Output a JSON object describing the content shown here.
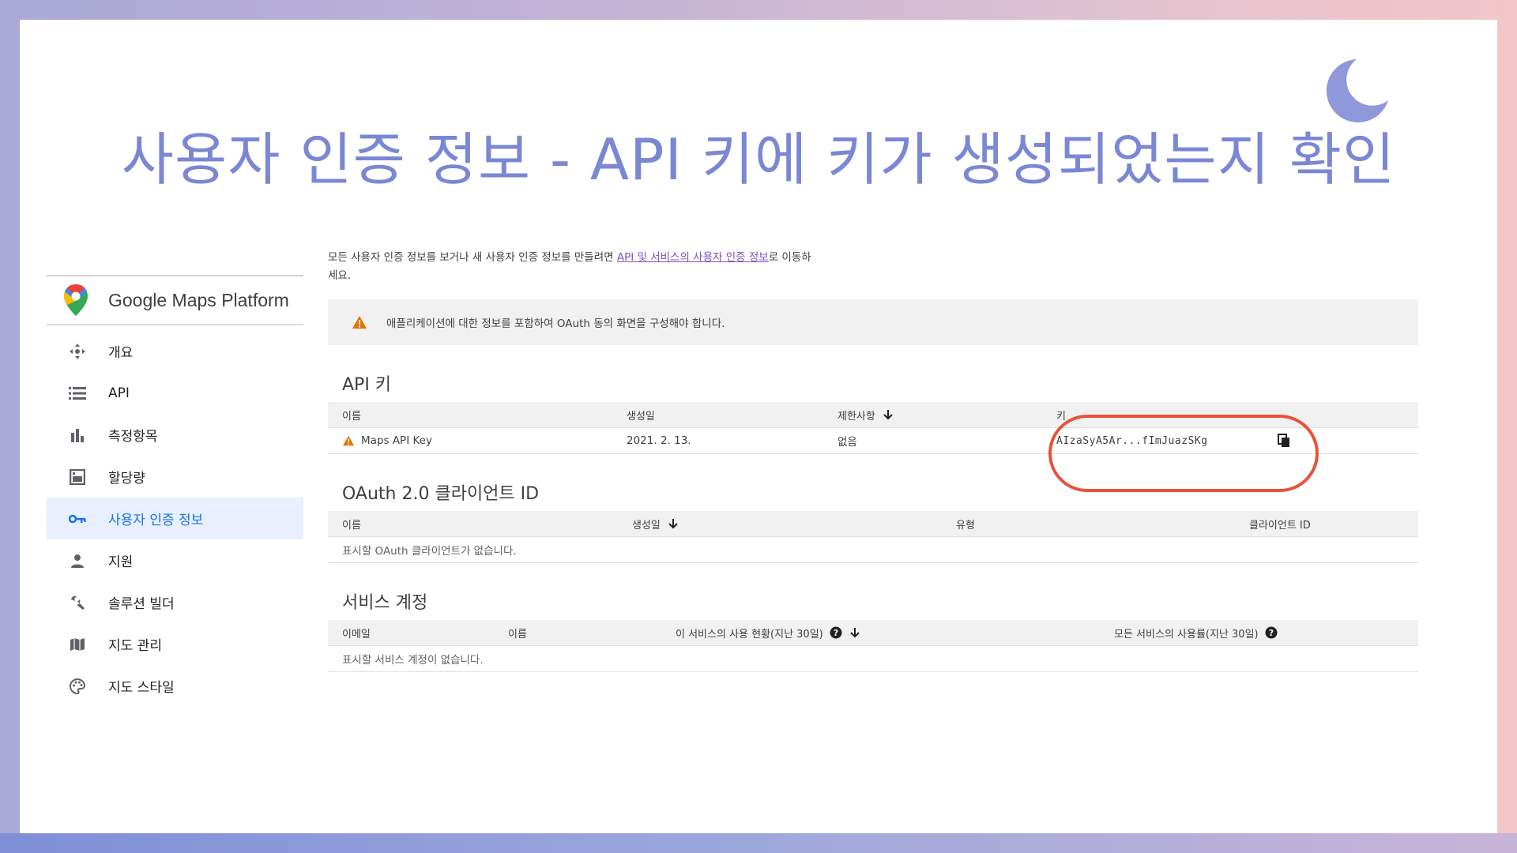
{
  "slide": {
    "title": "사용자 인증 정보 - API 키에 키가 생성되었는지 확인"
  },
  "sidebar": {
    "brand": "Google Maps Platform",
    "items": [
      {
        "label": "개요",
        "icon": "overview-icon"
      },
      {
        "label": "API",
        "icon": "list-icon"
      },
      {
        "label": "측정항목",
        "icon": "bar-chart-icon"
      },
      {
        "label": "할당량",
        "icon": "quota-icon"
      },
      {
        "label": "사용자 인증 정보",
        "icon": "key-icon",
        "active": true
      },
      {
        "label": "지원",
        "icon": "person-icon"
      },
      {
        "label": "솔루션 빌더",
        "icon": "wrench-icon"
      },
      {
        "label": "지도 관리",
        "icon": "map-icon"
      },
      {
        "label": "지도 스타일",
        "icon": "palette-icon"
      }
    ]
  },
  "main": {
    "intro_text": "모든 사용자 인증 정보를 보거나 새 사용자 인증 정보를 만들려면 ",
    "intro_link": "API 및 서비스의 사용자 인증 정보",
    "intro_suffix": "로 이동하세요.",
    "alert": "애플리케이션에 대한 정보를 포함하여 OAuth 동의 화면을 구성해야 합니다.",
    "api_keys": {
      "title": "API 키",
      "columns": [
        "이름",
        "생성일",
        "제한사항",
        "키"
      ],
      "rows": [
        {
          "name": "Maps API Key",
          "created": "2021. 2. 13.",
          "restrictions": "없음",
          "key": "AIzaSyA5Ar...fImJuazSKg"
        }
      ]
    },
    "oauth": {
      "title": "OAuth 2.0 클라이언트 ID",
      "columns": [
        "이름",
        "생성일",
        "유형",
        "클라이언트 ID"
      ],
      "empty": "표시할 OAuth 클라이언트가 없습니다."
    },
    "service_accounts": {
      "title": "서비스 계정",
      "columns": [
        "이메일",
        "이름",
        "이 서비스의 사용 현황(지난 30일)",
        "모든 서비스의 사용률(지난 30일)"
      ],
      "empty": "표시할 서비스 계정이 없습니다."
    }
  },
  "colors": {
    "title": "#7a87d4",
    "accent": "#1a73e8",
    "highlight": "#e8513a",
    "warning": "#e37400"
  }
}
